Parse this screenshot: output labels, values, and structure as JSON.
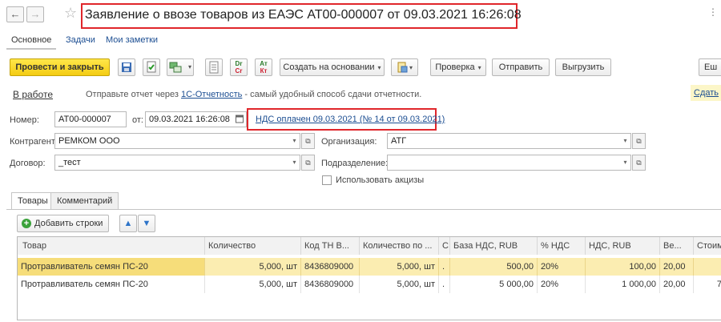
{
  "window": {
    "title": "Заявление о ввозе товаров из ЕАЭС АТ00-000007 от 09.03.2021 16:26:08",
    "more": "⋮"
  },
  "topnav": [
    "Основное",
    "Задачи",
    "Мои заметки"
  ],
  "toolbar": {
    "post_close": "Провести и закрыть",
    "create_based": "Создать на основании",
    "check": "Проверка",
    "send": "Отправить",
    "upload": "Выгрузить",
    "right_partial": "Еш",
    "dr_cr_top": "Dr",
    "dr_cr_bottom": "Cr",
    "at_kt_top": "Ат",
    "at_kt_bottom": "Кт"
  },
  "status": {
    "state": "В работе",
    "info_prefix": "Отправьте отчет через ",
    "info_link": "1С-Отчетность",
    "info_suffix": " - самый удобный способ сдачи отчетности.",
    "right_tag": "Сдать"
  },
  "form": {
    "number_label": "Номер:",
    "number_value": "АТ00-000007",
    "date_label": "от:",
    "date_value": "09.03.2021 16:26:08",
    "vat_link": "НДС оплачен 09.03.2021 (№ 14 от 09.03.2021)",
    "counterparty_label": "Контрагент:",
    "counterparty_value": "РЕМКОМ ООО",
    "organization_label": "Организация:",
    "organization_value": "АТГ",
    "contract_label": "Договор:",
    "contract_value": "_тест",
    "division_label": "Подразделение:",
    "division_value": "",
    "excise_label": "Использовать акцизы"
  },
  "tabs": [
    "Товары",
    "Комментарий"
  ],
  "table_toolbar": {
    "add_rows": "Добавить строки"
  },
  "table": {
    "columns": [
      "Товар",
      "Количество",
      "Код ТН В...",
      "Количество по ...",
      "С",
      "База НДС, RUB",
      "% НДС",
      "НДС, RUB",
      "Ве...",
      "Стоим"
    ],
    "rows": [
      [
        "Протравливатель семян ПС-20",
        "5,000, шт",
        "8436809000",
        "5,000, шт",
        ".",
        "500,00",
        "20%",
        "100,00",
        "20,00",
        ""
      ],
      [
        "Протравливатель семян ПС-20",
        "5,000, шт",
        "8436809000",
        "5,000, шт",
        ".",
        "5 000,00",
        "20%",
        "1 000,00",
        "20,00",
        "7"
      ]
    ]
  },
  "colors": {
    "highlight_border": "#e0262b",
    "primary_button": "#f4cc13",
    "selected_row": "#fbedb1",
    "link": "#1c4e92"
  }
}
